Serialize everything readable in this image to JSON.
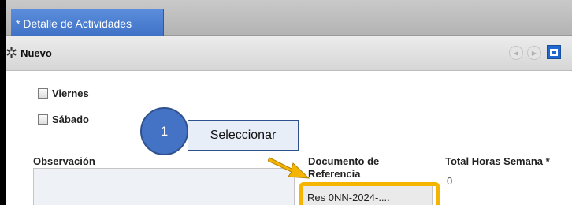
{
  "window": {
    "tab_title": "* Detalle de Actividades"
  },
  "toolbar": {
    "new_label": "Nuevo",
    "new_icon": "asterisk-icon",
    "prev_icon": "arrow-left-circle-icon",
    "next_icon": "arrow-right-circle-icon",
    "maximize_icon": "maximize-icon"
  },
  "form": {
    "friday_label": "Viernes",
    "saturday_label": "Sábado",
    "observation_label": "Observación",
    "docref_label_line1": "Documento de",
    "docref_label_line2": "Referencia",
    "docref_value": "Res 0NN-2024-....",
    "total_hours_label": "Total Horas Semana *",
    "total_hours_value": "0"
  },
  "callout": {
    "number": "1",
    "text": "Seleccionar",
    "highlight_color": "#f5b400"
  },
  "colors": {
    "tab": "#4a7fd3",
    "callout_circle": "#4472c4",
    "highlight": "#f5b400"
  }
}
